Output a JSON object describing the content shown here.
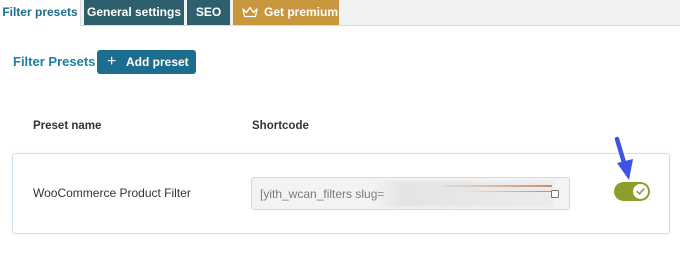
{
  "tabs": [
    {
      "label": "Filter presets"
    },
    {
      "label": "General settings"
    },
    {
      "label": "SEO"
    },
    {
      "label": "Get premium"
    }
  ],
  "main": {
    "title": "Filter Presets",
    "add_button_label": "Add preset",
    "columns": {
      "name": "Preset name",
      "shortcode": "Shortcode"
    },
    "rows": [
      {
        "name": "WooCommerce Product Filter",
        "shortcode": "[yith_wcan_filters slug=",
        "enabled": true
      }
    ]
  },
  "icons": {
    "crown": "crown-icon",
    "plus": "plus-icon",
    "check": "check-icon",
    "arrow": "arrow-down-icon"
  },
  "colors": {
    "tab_dark": "#2d5f6c",
    "tab_premium": "#c8973e",
    "accent": "#1d6d8e",
    "toggle_on": "#8c9f2e",
    "arrow": "#3d55e6"
  }
}
